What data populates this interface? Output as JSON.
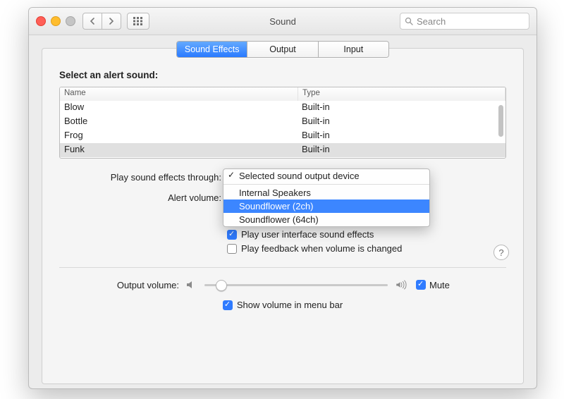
{
  "window": {
    "title": "Sound"
  },
  "search": {
    "placeholder": "Search"
  },
  "tabs": [
    {
      "label": "Sound Effects",
      "active": true
    },
    {
      "label": "Output",
      "active": false
    },
    {
      "label": "Input",
      "active": false
    }
  ],
  "alert_section": {
    "heading": "Select an alert sound:",
    "columns": {
      "name": "Name",
      "type": "Type"
    },
    "rows": [
      {
        "name": "Blow",
        "type": "Built-in",
        "selected": false
      },
      {
        "name": "Bottle",
        "type": "Built-in",
        "selected": false
      },
      {
        "name": "Frog",
        "type": "Built-in",
        "selected": false
      },
      {
        "name": "Funk",
        "type": "Built-in",
        "selected": true
      }
    ]
  },
  "labels": {
    "play_through": "Play sound effects through:",
    "alert_volume": "Alert volume:",
    "ui_effects": "Play user interface sound effects",
    "feedback": "Play feedback when volume is changed",
    "output_volume": "Output volume:",
    "mute": "Mute",
    "menubar": "Show volume in menu bar"
  },
  "output_device_menu": {
    "items": [
      {
        "label": "Selected sound output device",
        "checked": true,
        "highlighted": false
      },
      {
        "separator": true
      },
      {
        "label": "Internal Speakers",
        "checked": false,
        "highlighted": false
      },
      {
        "label": "Soundflower (2ch)",
        "checked": false,
        "highlighted": true
      },
      {
        "label": "Soundflower (64ch)",
        "checked": false,
        "highlighted": false
      }
    ]
  },
  "checkboxes": {
    "ui_effects": true,
    "feedback": false,
    "mute": true,
    "menubar": true
  }
}
